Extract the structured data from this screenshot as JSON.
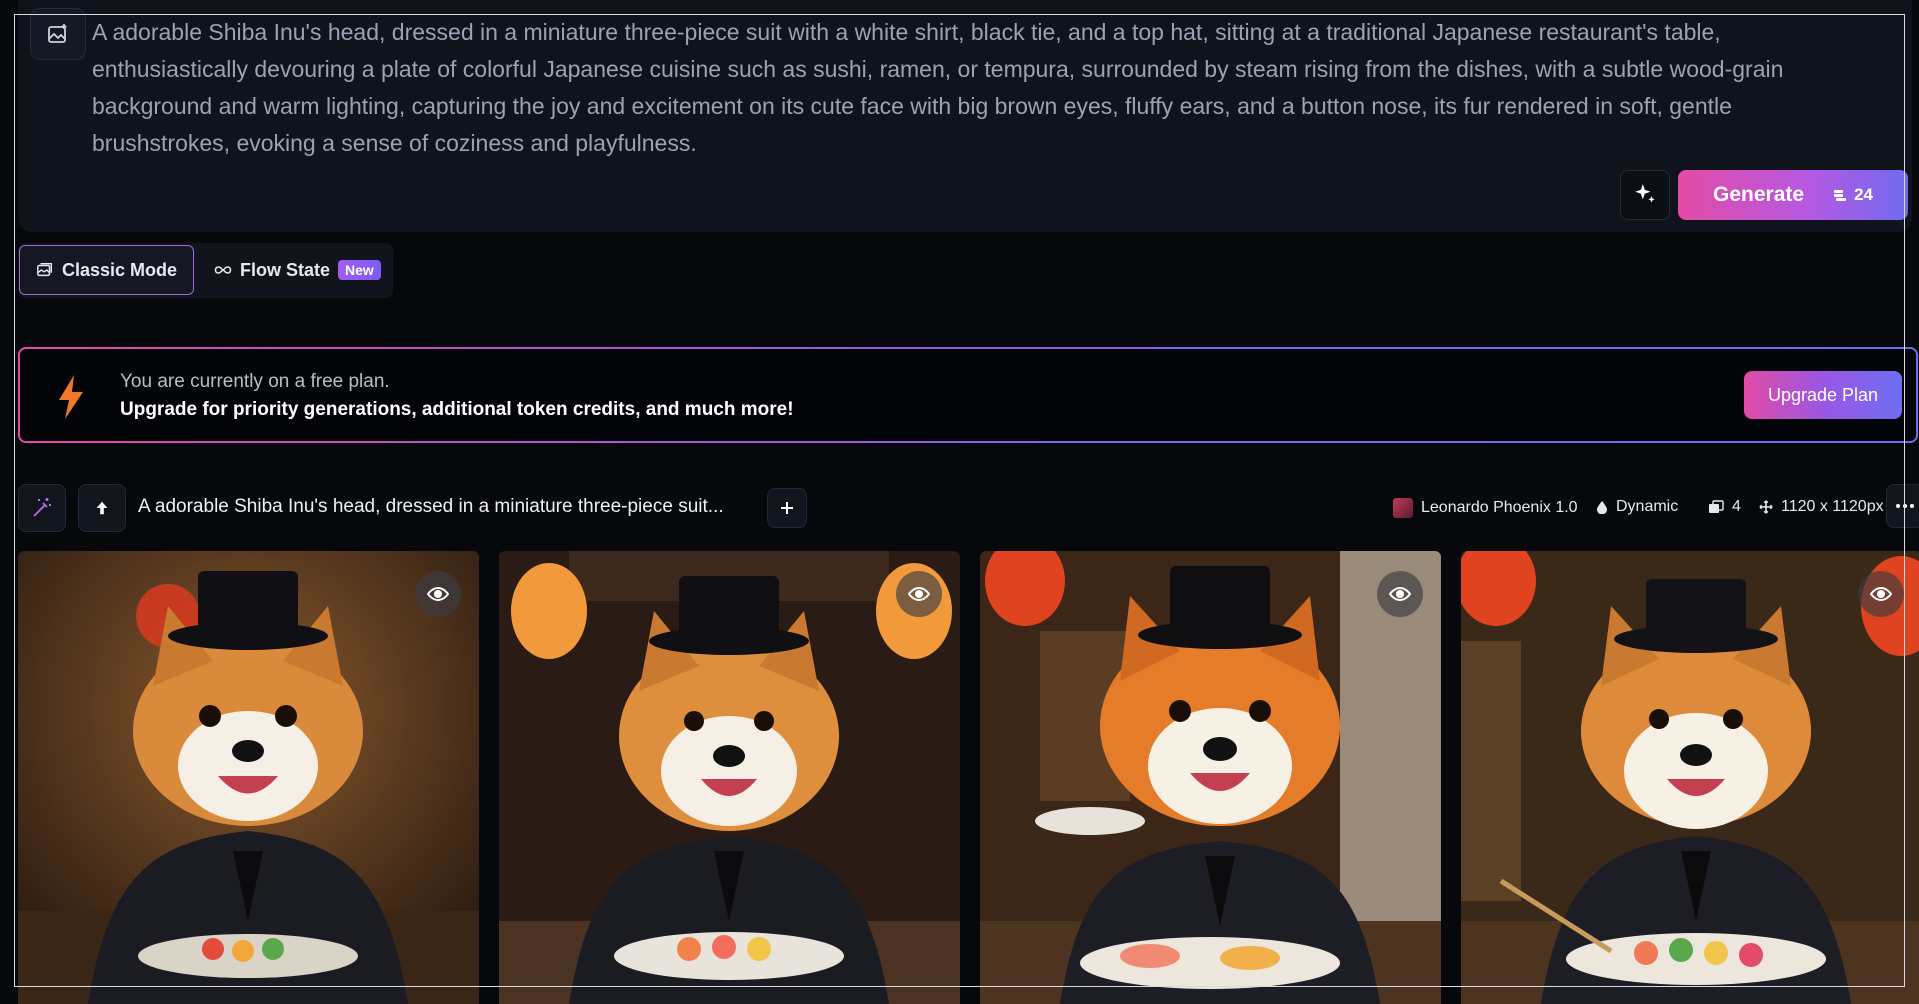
{
  "prompt": {
    "text": "A adorable Shiba Inu's head, dressed in a miniature three-piece suit with a white shirt, black tie, and a top hat, sitting at a traditional Japanese restaurant's table, enthusiastically devouring a plate of colorful Japanese cuisine such as sushi, ramen, or tempura, surrounded by steam rising from the dishes, with a subtle wood-grain background and warm lighting, capturing the joy and excitement on its cute face with big brown eyes, fluffy ears, and a button nose, its fur rendered in soft, gentle brushstrokes, evoking a sense of coziness and playfulness.",
    "icon": "image-sparkle-icon"
  },
  "generate": {
    "label": "Generate",
    "token_cost": "24",
    "icon": "token-stack-icon"
  },
  "magic_button_icon": "sparkles-icon",
  "modes": {
    "classic": {
      "label": "Classic Mode",
      "icon": "gallery-icon"
    },
    "flow": {
      "label": "Flow State",
      "icon": "infinity-icon",
      "badge": "New"
    }
  },
  "banner": {
    "line1": "You are currently on a free plan.",
    "line2": "Upgrade for priority generations, additional token credits, and much more!",
    "button": "Upgrade Plan",
    "icon": "lightning-bolt-icon"
  },
  "generation": {
    "title": "A adorable Shiba Inu's head, dressed in a miniature three-piece suit...",
    "model": "Leonardo Phoenix 1.0",
    "style": "Dynamic",
    "count": "4",
    "size": "1120 x 1120px"
  },
  "colors": {
    "accent_pink": "#e24ba5",
    "accent_purple": "#9b56e6",
    "accent_blue": "#6e6ef2",
    "background": "#07080b",
    "panel": "#0f131c"
  }
}
